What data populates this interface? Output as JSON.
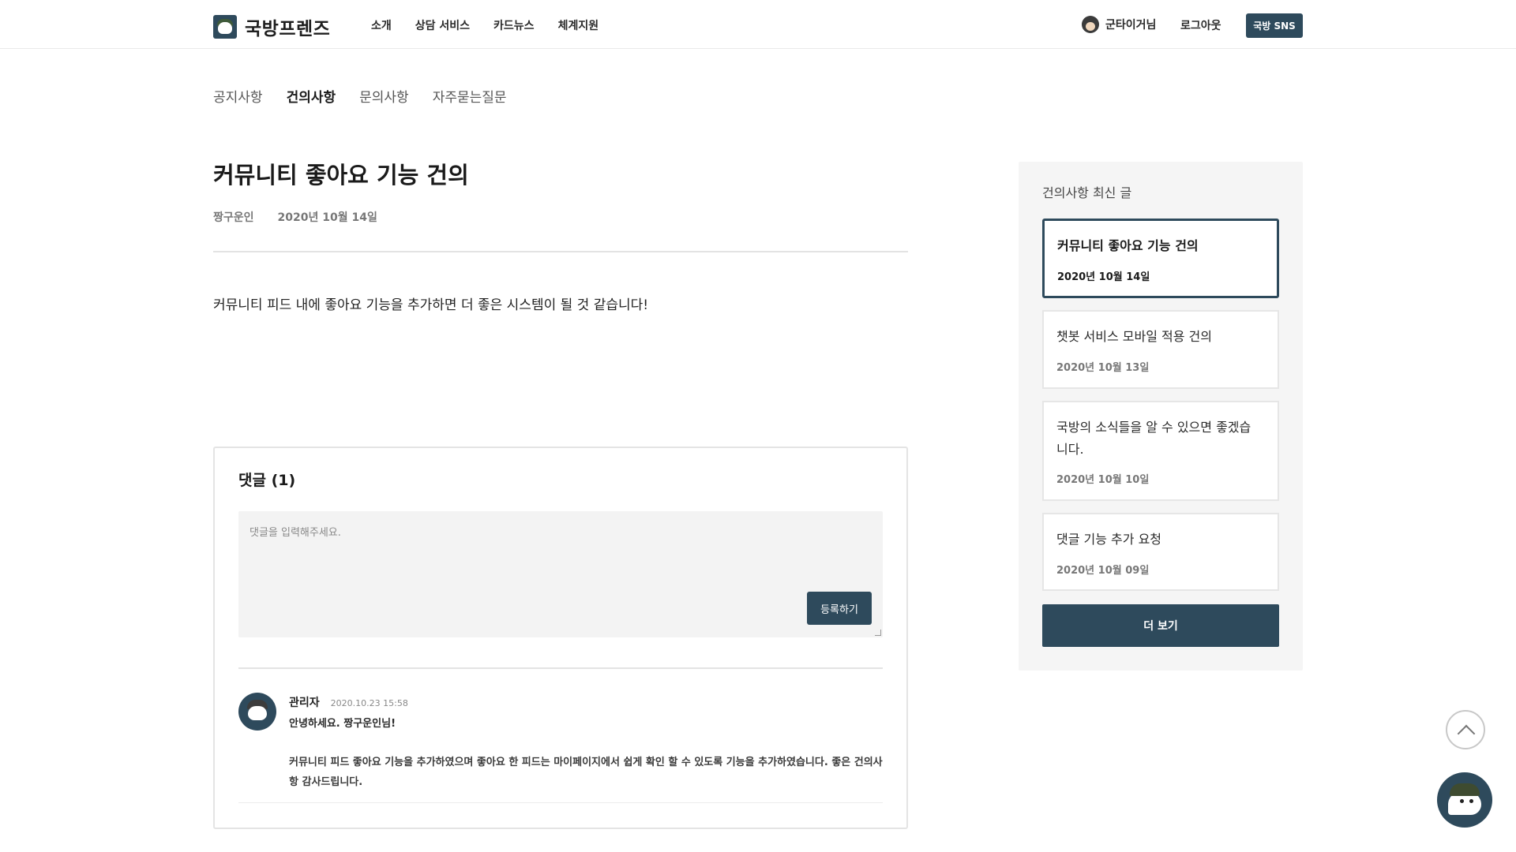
{
  "header": {
    "logo_text": "국방프렌즈",
    "nav": [
      "소개",
      "상담 서비스",
      "카드뉴스",
      "체계지원"
    ],
    "user_name": "군타이거님",
    "logout": "로그아웃",
    "sns_button": "국방 SNS"
  },
  "subtabs": [
    {
      "label": "공지사항",
      "active": false
    },
    {
      "label": "건의사항",
      "active": true
    },
    {
      "label": "문의사항",
      "active": false
    },
    {
      "label": "자주묻는질문",
      "active": false
    }
  ],
  "article": {
    "title": "커뮤니티 좋아요 기능 건의",
    "author": "짱구운인",
    "date": "2020년 10월 14일",
    "body": "커뮤니티 피드 내에 좋아요 기능을 추가하면 더 좋은 시스템이 될 것 같습니다!"
  },
  "comments": {
    "title": "댓글 (1)",
    "placeholder": "댓글을 입력해주세요.",
    "submit_label": "등록하기",
    "reply": {
      "author": "관리자",
      "time": "2020.10.23 15:58",
      "greeting": "안녕하세요. 짱구운인님!",
      "text": "커뮤니티 피드 좋아요 기능을 추가하였으며 좋아요 한 피드는 마이페이지에서 쉽게 확인 할 수 있도록 기능을 추가하였습니다. 좋은 건의사항 감사드립니다."
    }
  },
  "sidebar": {
    "title": "건의사항 최신 글",
    "posts": [
      {
        "title": "커뮤니티 좋아요 기능 건의",
        "date": "2020년 10월 14일",
        "active": true
      },
      {
        "title": "챗봇 서비스 모바일 적용 건의",
        "date": "2020년 10월 13일",
        "active": false
      },
      {
        "title": "국방의 소식들을 알 수 있으면 좋겠습니다.",
        "date": "2020년 10월 10일",
        "active": false
      },
      {
        "title": "댓글 기능 추가 요청",
        "date": "2020년 10월 09일",
        "active": false
      }
    ],
    "more_button": "더 보기"
  },
  "icons": {
    "logo": "soldier-face-icon",
    "scroll_top": "chevron-up-icon",
    "chatbot": "chatbot-soldier-icon"
  },
  "colors": {
    "primary": "#2e4a5c",
    "sidebar_bg": "#f5f5f5",
    "input_bg": "#f3f3f3"
  }
}
